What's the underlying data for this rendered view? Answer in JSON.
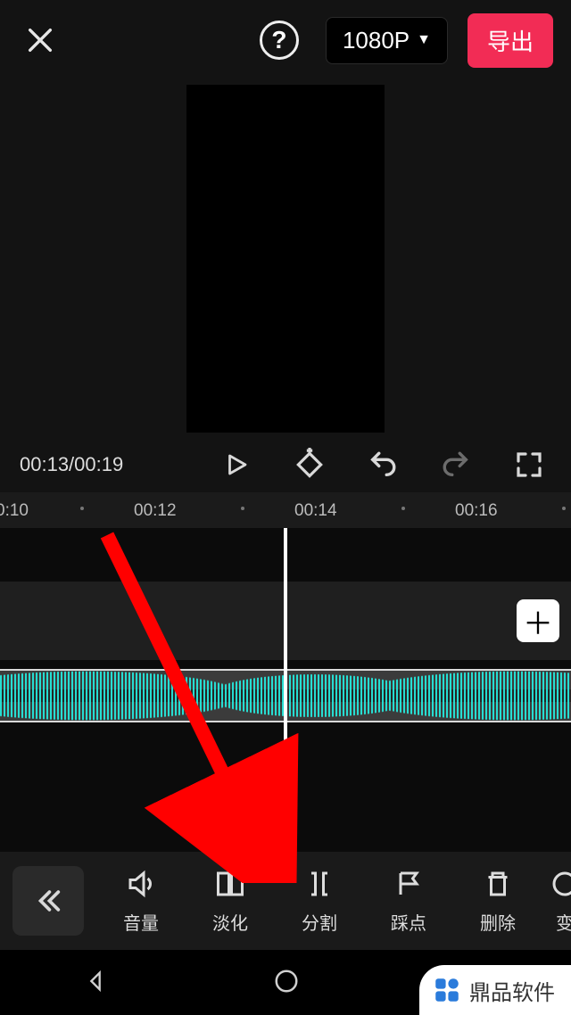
{
  "header": {
    "resolution_label": "1080P",
    "export_label": "导出"
  },
  "playback": {
    "current_time": "00:13",
    "total_time": "00:19",
    "time_display": "00:13/00:19"
  },
  "ruler": {
    "marks": [
      "0:10",
      "00:12",
      "00:14",
      "00:16"
    ]
  },
  "toolbar": {
    "items": [
      {
        "id": "volume",
        "label": "音量"
      },
      {
        "id": "fade",
        "label": "淡化"
      },
      {
        "id": "split",
        "label": "分割"
      },
      {
        "id": "beat",
        "label": "踩点"
      },
      {
        "id": "delete",
        "label": "删除"
      },
      {
        "id": "change",
        "label": "变"
      }
    ]
  },
  "watermark": {
    "text": "鼎品软件"
  }
}
